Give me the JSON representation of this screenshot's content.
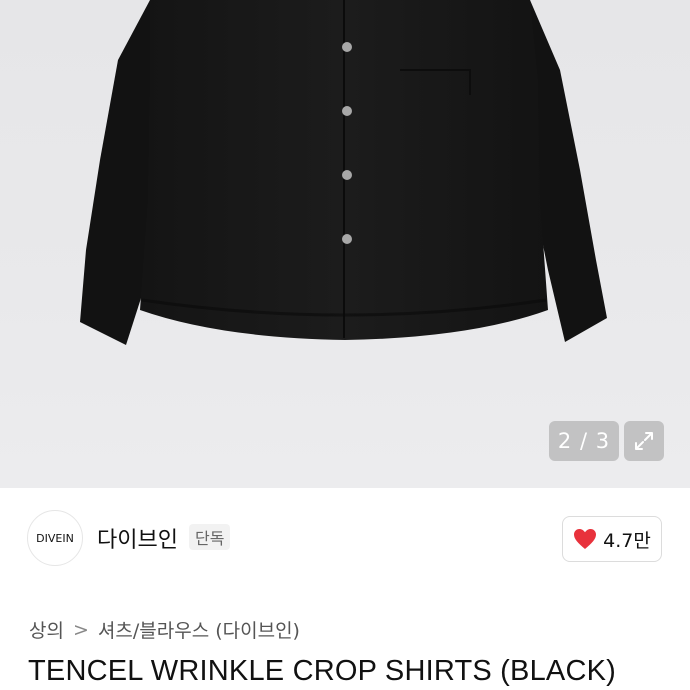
{
  "gallery": {
    "counter": "2 / 3",
    "image_alt": "black shirt",
    "expand_icon": "expand-icon"
  },
  "brand": {
    "logo_text": "DIVEIN",
    "name": "다이브인",
    "badge": "단독"
  },
  "like": {
    "icon": "heart-icon",
    "count": "4.7만",
    "color": "#e8323c"
  },
  "breadcrumb": {
    "category": "상의",
    "separator": ">",
    "subcategory": "셔츠/블라우스 (다이브인)"
  },
  "product": {
    "title": "TENCEL WRINKLE CROP SHIRTS (BLACK)"
  }
}
